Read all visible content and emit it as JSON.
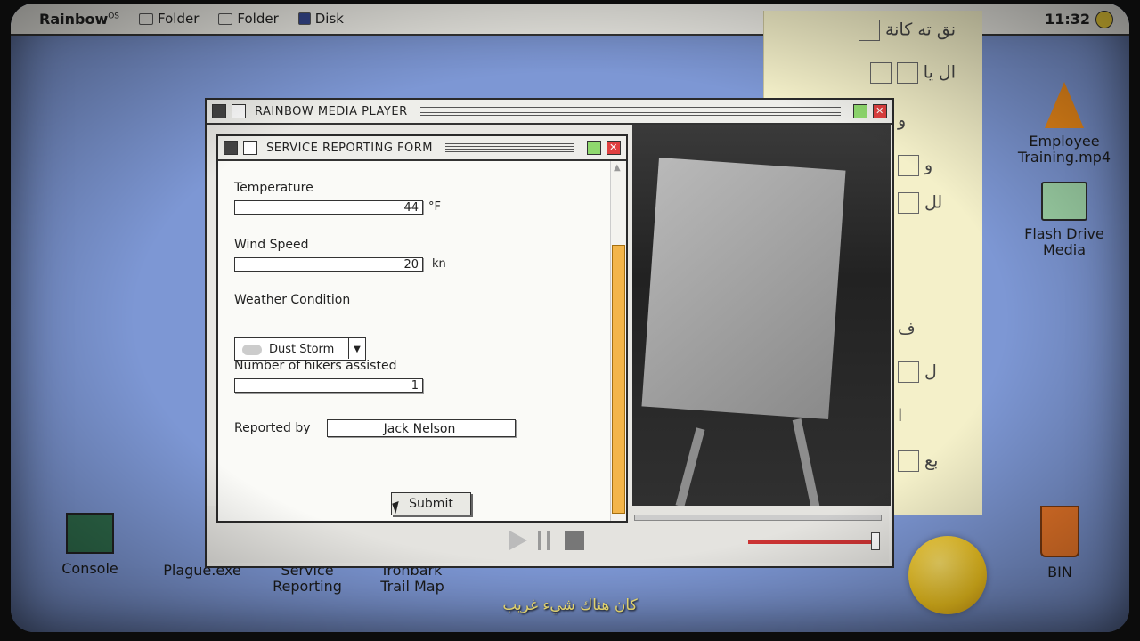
{
  "menubar": {
    "logo": "Rainbow",
    "logo_sup": "OS",
    "items": [
      {
        "label": "Folder",
        "icon": "folder-icon"
      },
      {
        "label": "Folder",
        "icon": "folder-icon"
      },
      {
        "label": "Disk",
        "icon": "disk-icon"
      }
    ],
    "clock": "11:32"
  },
  "note": {
    "lines": [
      "نق ته كانة",
      "ال يا",
      "و",
      "و",
      "لل",
      "ف",
      "ل",
      "ا",
      "بع"
    ]
  },
  "desktop_icons": [
    {
      "label1": "Employee",
      "label2": "Training.mp4"
    },
    {
      "label1": "Flash Drive",
      "label2": "Media"
    },
    {
      "label1": "Console",
      "label2": ""
    },
    {
      "label1": "Plague.exe",
      "label2": ""
    },
    {
      "label1": "Service",
      "label2": "Reporting"
    },
    {
      "label1": "Ironbark",
      "label2": "Trail Map"
    },
    {
      "label1": "BIN",
      "label2": ""
    }
  ],
  "media_player": {
    "title": "RAINBOW MEDIA PLAYER",
    "volume_level": 0.97
  },
  "form": {
    "title": "SERVICE REPORTING FORM",
    "temperature": {
      "label": "Temperature",
      "value": "44",
      "unit": "°F"
    },
    "wind": {
      "label": "Wind Speed",
      "value": "20",
      "unit": "kn"
    },
    "weather": {
      "label": "Weather Condition",
      "value": "Dust Storm"
    },
    "hikers": {
      "label": "Number of hikers assisted",
      "value": "1"
    },
    "reported_by": {
      "label": "Reported by",
      "value": "Jack Nelson"
    },
    "submit_label": "Submit"
  },
  "subtitle": "كان هناك شيء غريب",
  "colors": {
    "desktop": "#7d97d4",
    "scroll_thumb": "#f3b54a",
    "note": "#f4f0c9",
    "close": "#e04040"
  }
}
